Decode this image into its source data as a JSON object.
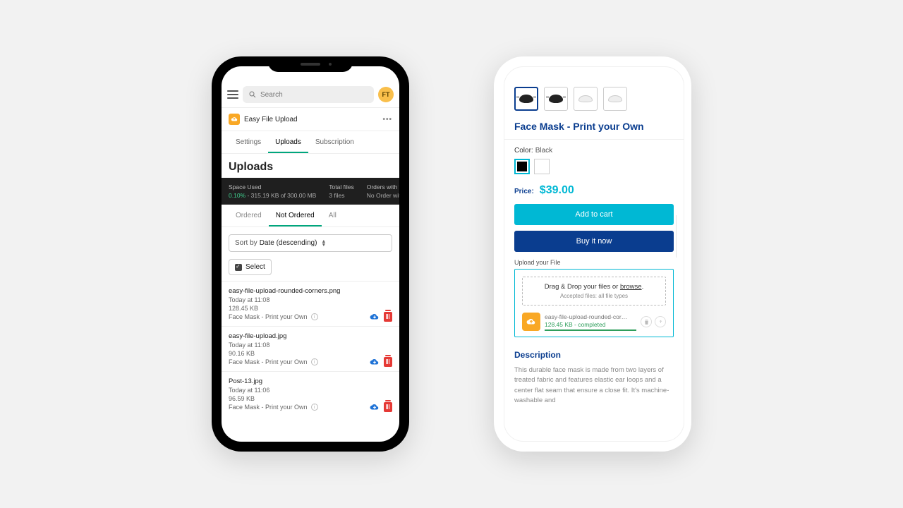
{
  "left": {
    "search_placeholder": "Search",
    "avatar_initials": "FT",
    "app_name": "Easy File Upload",
    "tabs": {
      "settings": "Settings",
      "uploads": "Uploads",
      "subscription": "Subscription"
    },
    "page_title": "Uploads",
    "stats": {
      "space_label": "Space Used",
      "space_pct": "0.10%",
      "space_detail": " - 315.19 KB of 300.00 MB",
      "total_label": "Total files",
      "total_val": "3 files",
      "orders_label": "Orders with files",
      "orders_val": "No Order with files yet"
    },
    "subtabs": {
      "ordered": "Ordered",
      "not_ordered": "Not Ordered",
      "all": "All"
    },
    "sort_prefix": "Sort by ",
    "sort_value": "Date (descending)",
    "select_label": "Select",
    "files": [
      {
        "name": "easy-file-upload-rounded-corners.png",
        "time": "Today at 11:08",
        "size": "128.45 KB",
        "product": "Face Mask - Print your Own"
      },
      {
        "name": "easy-file-upload.jpg",
        "time": "Today at 11:08",
        "size": "90.16 KB",
        "product": "Face Mask - Print your Own"
      },
      {
        "name": "Post-13.jpg",
        "time": "Today at 11:06",
        "size": "96.59 KB",
        "product": "Face Mask - Print your Own"
      }
    ]
  },
  "right": {
    "product_title": "Face Mask - Print your Own",
    "color_label": "Color:",
    "color_value": "Black",
    "price_label": "Price:",
    "price_value": "$39.00",
    "add_to_cart": "Add to cart",
    "buy_now": "Buy it now",
    "upload_label": "Upload your File",
    "drag_text_a": "Drag & Drop your files or ",
    "drag_text_b": "browse",
    "accepted": "Accepted files: all file types",
    "uploaded_name": "easy-file-upload-rounded-cor…",
    "uploaded_status": "128.45 KB - completed",
    "desc_heading": "Description",
    "desc_text": "This durable face mask is made from two layers of treated fabric and features elastic ear loops and a center flat seam that ensure a close fit. It's machine-washable and"
  }
}
